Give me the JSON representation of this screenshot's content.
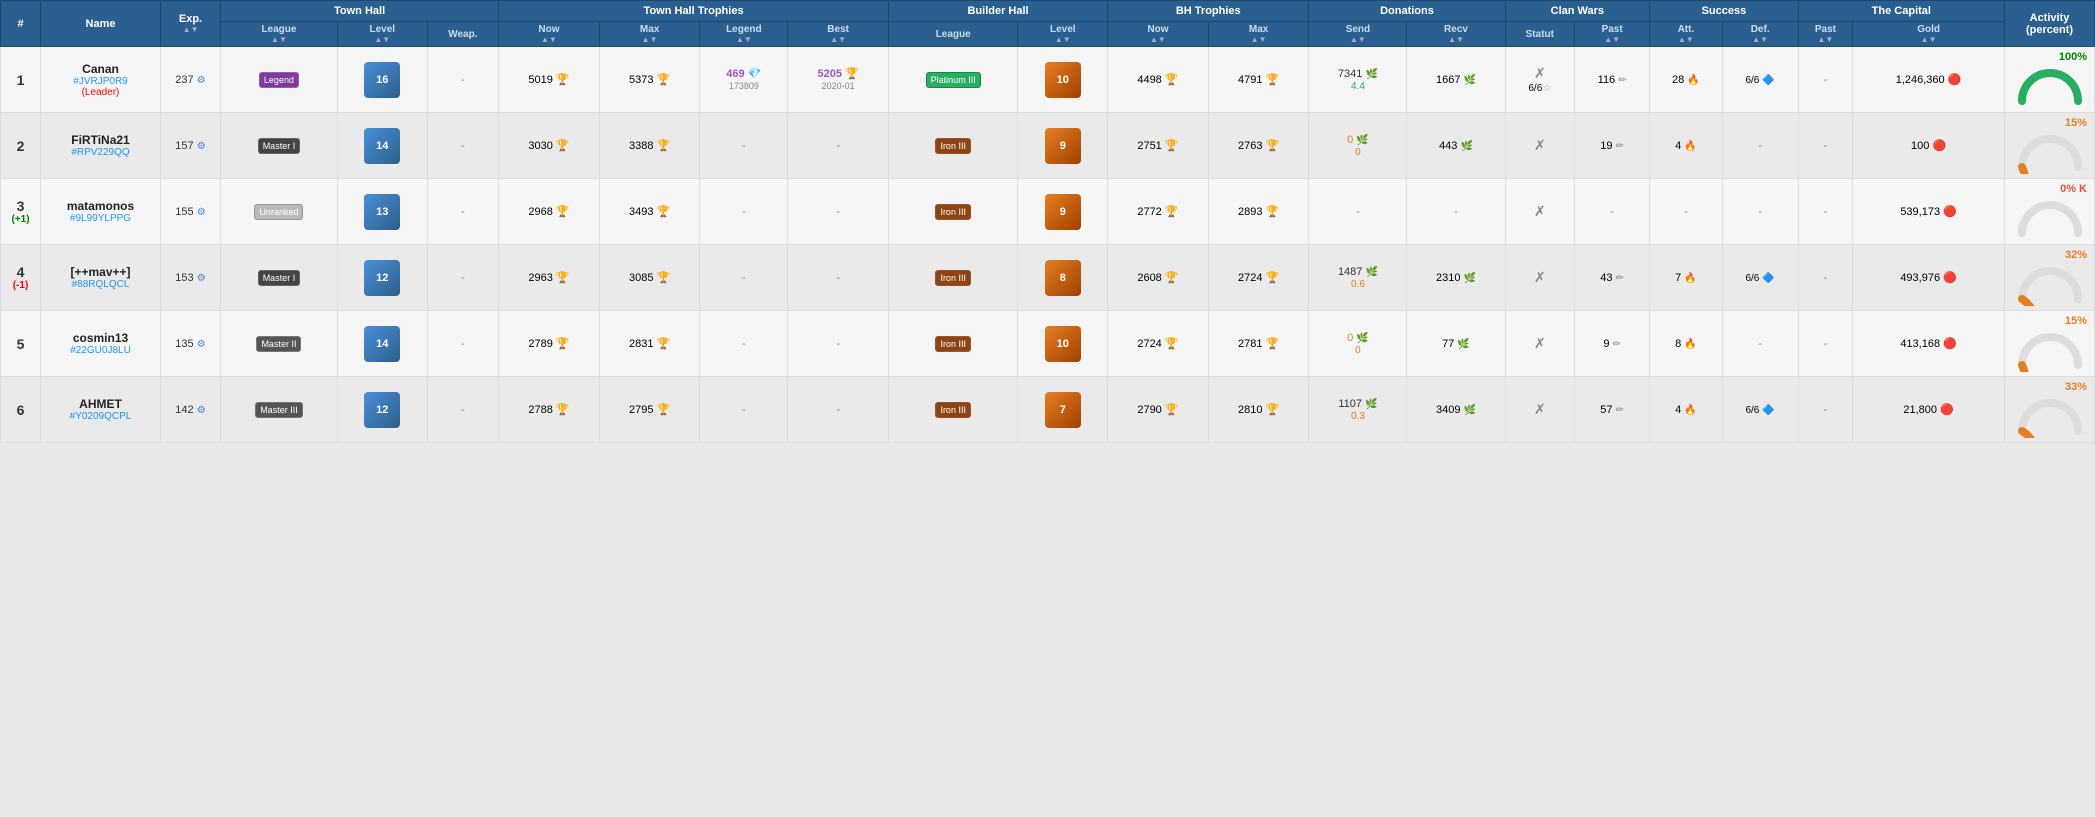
{
  "headers": {
    "rank": "#",
    "name": "Name",
    "exp": "Exp.",
    "townhall": "Town Hall",
    "th_league": "League",
    "th_level": "Level",
    "th_weap": "Weap.",
    "trophies": "Town Hall Trophies",
    "tr_now": "Now",
    "tr_max": "Max",
    "tr_legend": "Legend",
    "tr_best": "Best",
    "builder_hall": "Builder Hall",
    "bh_league": "League",
    "bh_level": "Level",
    "bh_trophies": "BH Trophies",
    "bht_now": "Now",
    "bht_max": "Max",
    "donations": "Donations",
    "don_send": "Send",
    "don_recv": "Recv",
    "clanwars": "Clan Wars",
    "cw_status": "Statut",
    "cw_past": "Past",
    "success": "Success",
    "suc_att": "Att.",
    "suc_def": "Def.",
    "capital": "The Capital",
    "cap_past": "Past",
    "cap_gold": "Gold",
    "activity": "Activity (percent)"
  },
  "players": [
    {
      "rank": "1",
      "rank_change": "",
      "name": "Canan",
      "tag": "#JVRJP0R9",
      "role": "Leader",
      "exp": "237",
      "th_league": "Legend",
      "th_level": "16",
      "th_weap": "-",
      "tr_now": "5019",
      "tr_max": "5373",
      "tr_legend": "469",
      "tr_legend_date": "173809",
      "tr_best": "5205",
      "tr_best_date": "2020-01",
      "bh_league": "Platinum III",
      "bh_level": "10",
      "bht_now": "4498",
      "bht_max": "4791",
      "don_send": "7341",
      "don_recv": "1667",
      "don_ratio": "4.4",
      "cw_status": "✗",
      "cw_result": "6/6",
      "cw_star": "☆",
      "cw_past": "116",
      "cw_past_icon": "✏",
      "suc_att": "28",
      "suc_att_icon": "🔥",
      "suc_def": "6/6",
      "cap_past": "-",
      "cap_gold": "1246360",
      "activity_pct": "100%",
      "activity_color": "green",
      "activity_val": 100
    },
    {
      "rank": "2",
      "rank_change": "",
      "name": "FiRTiNa21",
      "tag": "#RPV229QQ",
      "role": "",
      "exp": "157",
      "th_league": "Master I",
      "th_level": "14",
      "th_weap": "-",
      "tr_now": "3030",
      "tr_max": "3388",
      "tr_legend": "-",
      "tr_legend_date": "",
      "tr_best": "-",
      "tr_best_date": "",
      "bh_league": "Iron III",
      "bh_level": "9",
      "bht_now": "2751",
      "bht_max": "2763",
      "don_send": "0",
      "don_recv": "443",
      "don_ratio": "0",
      "cw_status": "✗",
      "cw_result": "-",
      "cw_star": "",
      "cw_past": "19",
      "cw_past_icon": "✏",
      "suc_att": "4",
      "suc_att_icon": "🔥",
      "suc_def": "-",
      "cap_past": "-",
      "cap_gold": "100",
      "activity_pct": "15%",
      "activity_color": "orange",
      "activity_val": 15
    },
    {
      "rank": "3",
      "rank_change": "+1",
      "name": "matamonos",
      "tag": "#9L99YLPPG",
      "role": "",
      "exp": "155",
      "th_league": "Unranked",
      "th_level": "13",
      "th_weap": "-",
      "tr_now": "2968",
      "tr_max": "3493",
      "tr_legend": "-",
      "tr_legend_date": "",
      "tr_best": "-",
      "tr_best_date": "",
      "bh_league": "Iron III",
      "bh_level": "9",
      "bht_now": "2772",
      "bht_max": "2893",
      "don_send": "-",
      "don_recv": "-",
      "don_ratio": "",
      "cw_status": "✗",
      "cw_result": "-",
      "cw_star": "",
      "cw_past": "-",
      "cw_past_icon": "",
      "suc_att": "-",
      "suc_att_icon": "",
      "suc_def": "-",
      "cap_past": "-",
      "cap_gold": "539173",
      "activity_pct": "0% K",
      "activity_color": "red",
      "activity_val": 0
    },
    {
      "rank": "4",
      "rank_change": "-1",
      "name": "[++mav++]",
      "tag": "#88RQLQCL",
      "role": "",
      "exp": "153",
      "th_league": "Master I",
      "th_level": "12",
      "th_weap": "-",
      "tr_now": "2963",
      "tr_max": "3085",
      "tr_legend": "-",
      "tr_legend_date": "",
      "tr_best": "-",
      "tr_best_date": "",
      "bh_league": "Iron III",
      "bh_level": "8",
      "bht_now": "2608",
      "bht_max": "2724",
      "don_send": "1487",
      "don_recv": "2310",
      "don_ratio": "0.6",
      "cw_status": "✗",
      "cw_result": "-",
      "cw_star": "",
      "cw_past": "43",
      "cw_past_icon": "✏",
      "suc_att": "7",
      "suc_att_icon": "🔥",
      "suc_def": "6/6",
      "cap_past": "-",
      "cap_gold": "493976",
      "activity_pct": "32%",
      "activity_color": "orange",
      "activity_val": 32
    },
    {
      "rank": "5",
      "rank_change": "",
      "name": "cosmin13",
      "tag": "#22GU0J8LU",
      "role": "",
      "exp": "135",
      "th_league": "Master II",
      "th_level": "14",
      "th_weap": "-",
      "tr_now": "2789",
      "tr_max": "2831",
      "tr_legend": "-",
      "tr_legend_date": "",
      "tr_best": "-",
      "tr_best_date": "",
      "bh_league": "Iron III",
      "bh_level": "10",
      "bht_now": "2724",
      "bht_max": "2781",
      "don_send": "0",
      "don_recv": "77",
      "don_ratio": "0",
      "cw_status": "✗",
      "cw_result": "-",
      "cw_star": "",
      "cw_past": "9",
      "cw_past_icon": "✏",
      "suc_att": "8",
      "suc_att_icon": "🔥",
      "suc_def": "-",
      "cap_past": "-",
      "cap_gold": "413168",
      "activity_pct": "15%",
      "activity_color": "orange",
      "activity_val": 15
    },
    {
      "rank": "6",
      "rank_change": "",
      "name": "AHMET",
      "tag": "#Y0209QCPL",
      "role": "",
      "exp": "142",
      "th_league": "Master III",
      "th_level": "12",
      "th_weap": "-",
      "tr_now": "2788",
      "tr_max": "2795",
      "tr_legend": "-",
      "tr_legend_date": "",
      "tr_best": "-",
      "tr_best_date": "",
      "bh_league": "Iron III",
      "bh_level": "7",
      "bht_now": "2790",
      "bht_max": "2810",
      "don_send": "1107",
      "don_recv": "3409",
      "don_ratio": "0.3",
      "cw_status": "✗",
      "cw_result": "-",
      "cw_star": "",
      "cw_past": "57",
      "cw_past_icon": "✏",
      "suc_att": "4",
      "suc_att_icon": "🔥",
      "suc_def": "6/6",
      "cap_past": "-",
      "cap_gold": "21800",
      "activity_pct": "33%",
      "activity_color": "orange",
      "activity_val": 33
    }
  ]
}
